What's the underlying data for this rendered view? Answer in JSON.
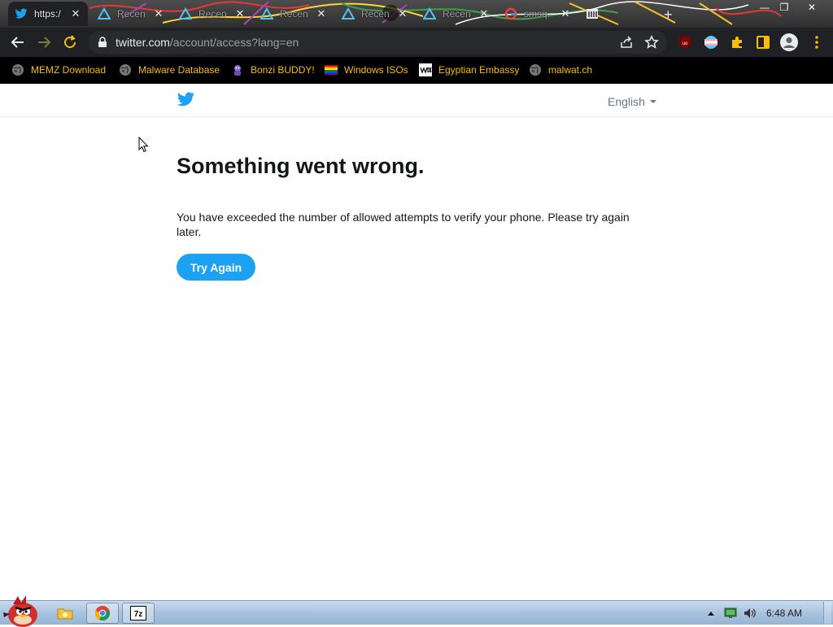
{
  "browser": {
    "tabs": [
      {
        "title": "https:/",
        "icon": "twitter-icon",
        "active": true
      },
      {
        "title": "Recen",
        "icon": "triangle-icon"
      },
      {
        "title": "Recen",
        "icon": "triangle-icon"
      },
      {
        "title": "Recen",
        "icon": "triangle-icon"
      },
      {
        "title": "Recen",
        "icon": "triangle-icon"
      },
      {
        "title": "Recen",
        "icon": "triangle-icon"
      },
      {
        "title": "smsq",
        "icon": "google-icon"
      }
    ],
    "url_host": "twitter.com",
    "url_path": "/account/access?lang=en",
    "accent": "#202124"
  },
  "bookmarks": [
    {
      "label": "MEMZ Download",
      "icon": "globe-icon"
    },
    {
      "label": "Malware Database",
      "icon": "globe-icon"
    },
    {
      "label": "Bonzi BUDDY!",
      "icon": "bonzi-icon"
    },
    {
      "label": "Windows ISOs",
      "icon": "rainbow-flag-icon"
    },
    {
      "label": "Egyptian Embassy",
      "icon": "wix-icon"
    },
    {
      "label": "malwat.ch",
      "icon": "globe-icon"
    }
  ],
  "page": {
    "language": "English",
    "title": "Something went wrong.",
    "message": "You have exceeded the number of allowed attempts to verify your phone. Please try again later.",
    "button": "Try Again",
    "brand_color": "#1da1f2"
  },
  "taskbar": {
    "clock": "6:48 AM"
  }
}
